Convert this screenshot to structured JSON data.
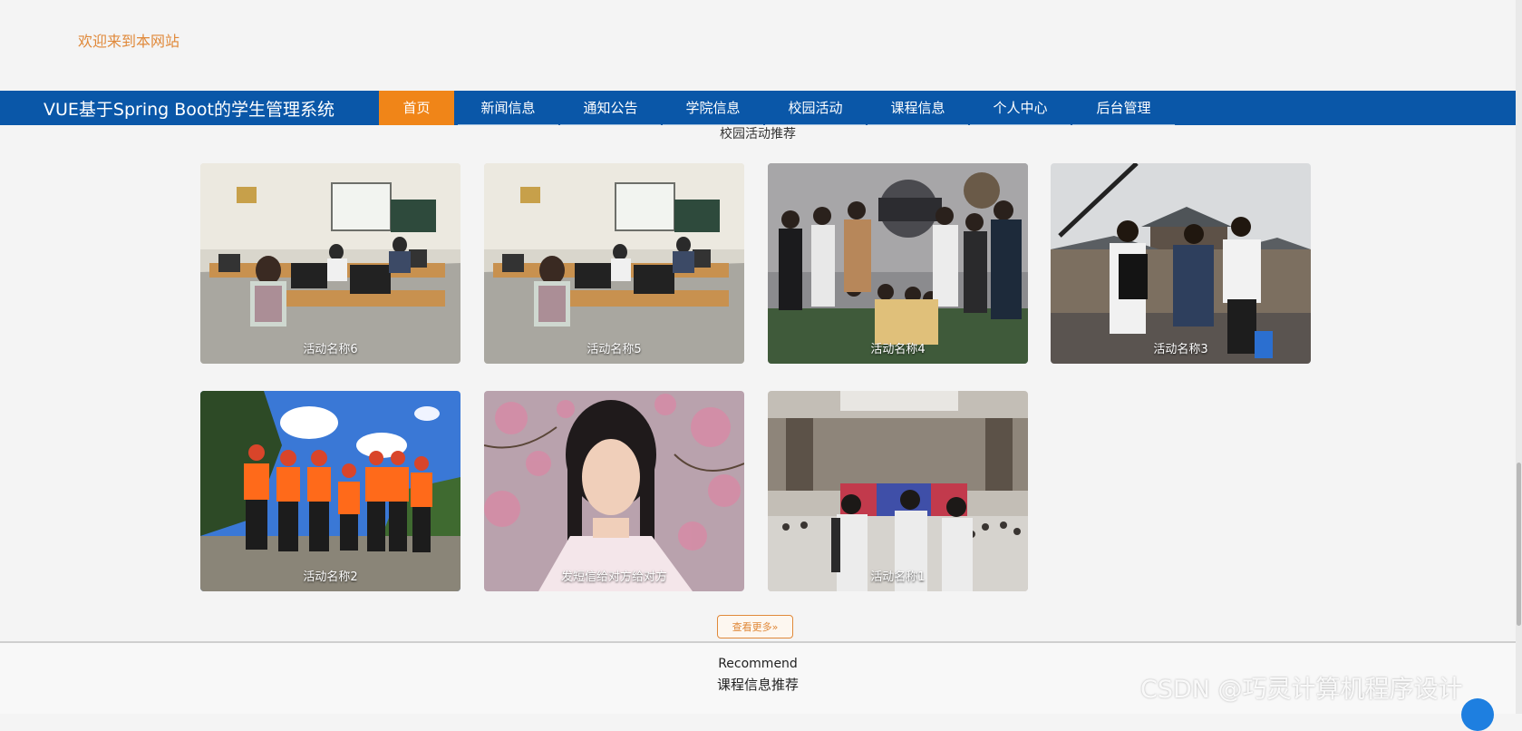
{
  "header": {
    "welcome": "欢迎来到本网站",
    "brand": "VUE基于Spring Boot的学生管理系统"
  },
  "nav": {
    "items": [
      {
        "label": "首页",
        "active": true
      },
      {
        "label": "新闻信息"
      },
      {
        "label": "通知公告"
      },
      {
        "label": "学院信息"
      },
      {
        "label": "校园活动"
      },
      {
        "label": "课程信息"
      },
      {
        "label": "个人中心"
      },
      {
        "label": "后台管理"
      }
    ]
  },
  "activities": {
    "section_title": "校园活动推荐",
    "cards": [
      {
        "name": "活动名称6",
        "image": "classroom-photo"
      },
      {
        "name": "活动名称5",
        "image": "classroom-photo"
      },
      {
        "name": "活动名称4",
        "image": "group-photo-indoor"
      },
      {
        "name": "活动名称3",
        "image": "group-photo-outdoor"
      },
      {
        "name": "活动名称2",
        "image": "team-outdoor-photo"
      },
      {
        "name": "发短信给对方给对方",
        "image": "portrait-blossom-photo"
      },
      {
        "name": "活动名称1",
        "image": "conference-hall-photo"
      }
    ],
    "more_label": "查看更多»"
  },
  "recommend": {
    "en_title": "Recommend",
    "title": "课程信息推荐"
  },
  "watermark": "CSDN @巧灵计算机程序设计",
  "colors": {
    "nav_bg": "#0a57a8",
    "nav_active": "#f08518",
    "accent_orange": "#e0893a",
    "background": "#f4f4f4"
  }
}
